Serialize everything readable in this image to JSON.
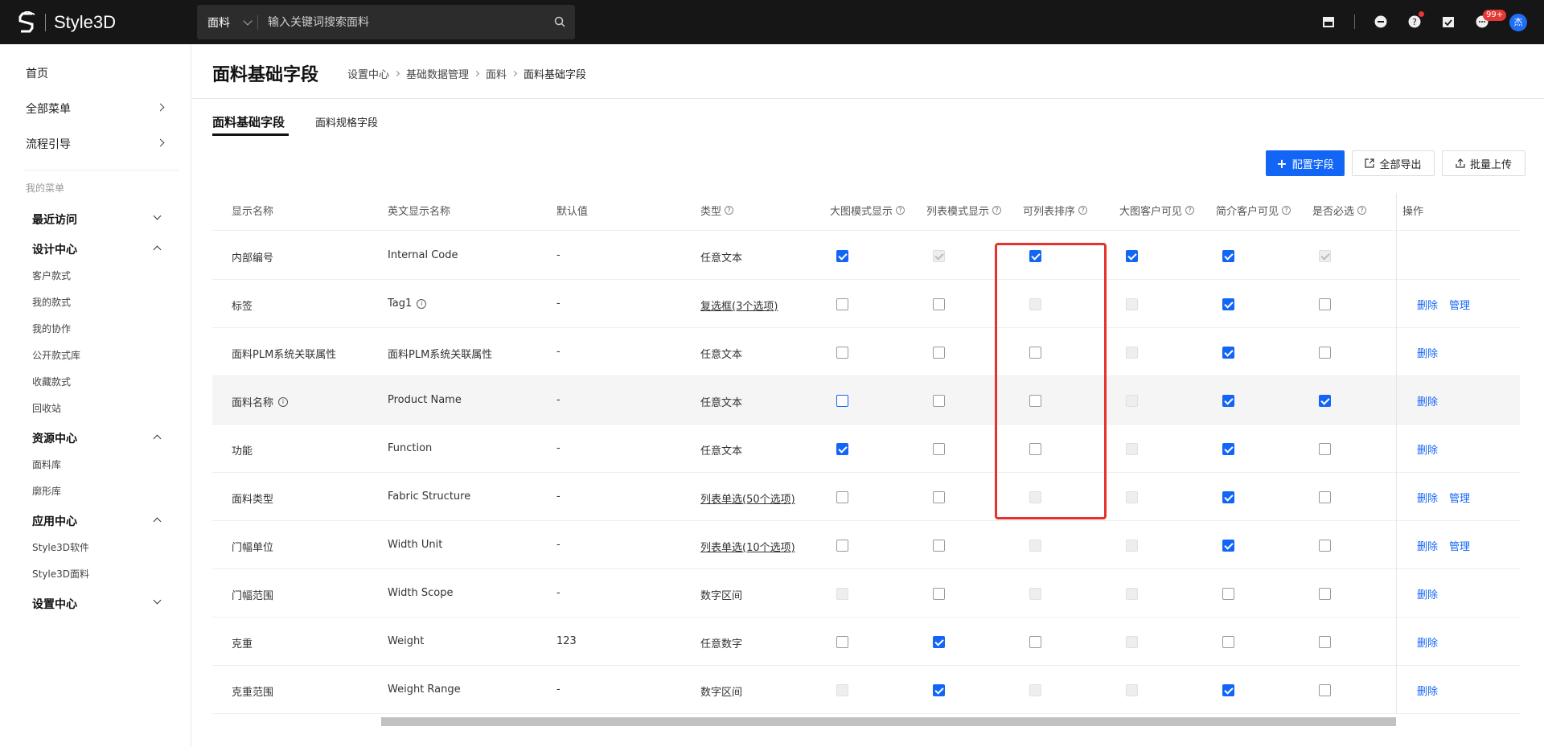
{
  "header": {
    "logo_text": "Style3D",
    "search_category": "面料",
    "search_placeholder": "输入关键词搜索面料",
    "notification_badge": "99+",
    "avatar_text": "杰"
  },
  "sidebar": {
    "home": "首页",
    "all_menu": "全部菜单",
    "process_guide": "流程引导",
    "my_menu_label": "我的菜单",
    "groups": [
      {
        "label": "最近访问",
        "items": []
      },
      {
        "label": "设计中心",
        "items": [
          "客户款式",
          "我的款式",
          "我的协作",
          "公开款式库",
          "收藏款式",
          "回收站"
        ]
      },
      {
        "label": "资源中心",
        "items": [
          "面料库",
          "廓形库"
        ]
      },
      {
        "label": "应用中心",
        "items": [
          "Style3D软件",
          "Style3D面料"
        ]
      },
      {
        "label": "设置中心",
        "items": []
      }
    ]
  },
  "page": {
    "title": "面料基础字段",
    "breadcrumb": [
      "设置中心",
      "基础数据管理",
      "面料",
      "面料基础字段"
    ],
    "tabs": [
      "面料基础字段",
      "面料规格字段"
    ],
    "buttons": {
      "config": "配置字段",
      "export": "全部导出",
      "upload": "批量上传"
    }
  },
  "table": {
    "headers": [
      "显示名称",
      "英文显示名称",
      "默认值",
      "类型",
      "大图模式显示",
      "列表模式显示",
      "可列表排序",
      "大图客户可见",
      "简介客户可见",
      "是否必选",
      "操作"
    ],
    "rows": [
      {
        "name": "内部编号",
        "en": "Internal Code",
        "default": "-",
        "type": "任意文本",
        "type_link": false,
        "checks": [
          "on",
          "don",
          "on",
          "on",
          "on",
          "don"
        ],
        "actions": []
      },
      {
        "name": "标签",
        "en": "Tag1",
        "en_info": true,
        "default": "-",
        "type": "复选框(3个选项)",
        "type_link": true,
        "checks": [
          "off",
          "off",
          "dis",
          "dis",
          "on",
          "off"
        ],
        "actions": [
          "删除",
          "管理"
        ]
      },
      {
        "name": "面料PLM系统关联属性",
        "en": "面料PLM系统关联属性",
        "default": "-",
        "type": "任意文本",
        "type_link": false,
        "checks": [
          "off",
          "off",
          "off",
          "dis",
          "on",
          "off"
        ],
        "actions": [
          "删除"
        ]
      },
      {
        "name": "面料名称",
        "name_info": true,
        "en": "Product Name",
        "default": "-",
        "type": "任意文本",
        "type_link": false,
        "checks": [
          "focus",
          "off",
          "off",
          "dis",
          "on",
          "on"
        ],
        "actions": [
          "删除"
        ]
      },
      {
        "name": "功能",
        "en": "Function",
        "default": "-",
        "type": "任意文本",
        "type_link": false,
        "checks": [
          "on",
          "off",
          "off",
          "dis",
          "on",
          "off"
        ],
        "actions": [
          "删除"
        ]
      },
      {
        "name": "面料类型",
        "en": "Fabric Structure",
        "default": "-",
        "type": "列表单选(50个选项)",
        "type_link": true,
        "checks": [
          "off",
          "off",
          "dis",
          "dis",
          "on",
          "off"
        ],
        "actions": [
          "删除",
          "管理"
        ]
      },
      {
        "name": "门幅单位",
        "en": "Width Unit",
        "default": "-",
        "type": "列表单选(10个选项)",
        "type_link": true,
        "checks": [
          "off",
          "off",
          "dis",
          "dis",
          "on",
          "off"
        ],
        "actions": [
          "删除",
          "管理"
        ]
      },
      {
        "name": "门幅范围",
        "en": "Width Scope",
        "default": "-",
        "type": "数字区间",
        "type_link": false,
        "checks": [
          "dis",
          "off",
          "dis",
          "dis",
          "off",
          "off"
        ],
        "actions": [
          "删除"
        ]
      },
      {
        "name": "克重",
        "en": "Weight",
        "default": "123",
        "type": "任意数字",
        "type_link": false,
        "checks": [
          "off",
          "on",
          "off",
          "dis",
          "off",
          "off"
        ],
        "actions": [
          "删除"
        ]
      },
      {
        "name": "克重范围",
        "en": "Weight Range",
        "default": "-",
        "type": "数字区间",
        "type_link": false,
        "checks": [
          "dis",
          "on",
          "dis",
          "dis",
          "on",
          "off"
        ],
        "actions": [
          "删除"
        ]
      }
    ]
  }
}
